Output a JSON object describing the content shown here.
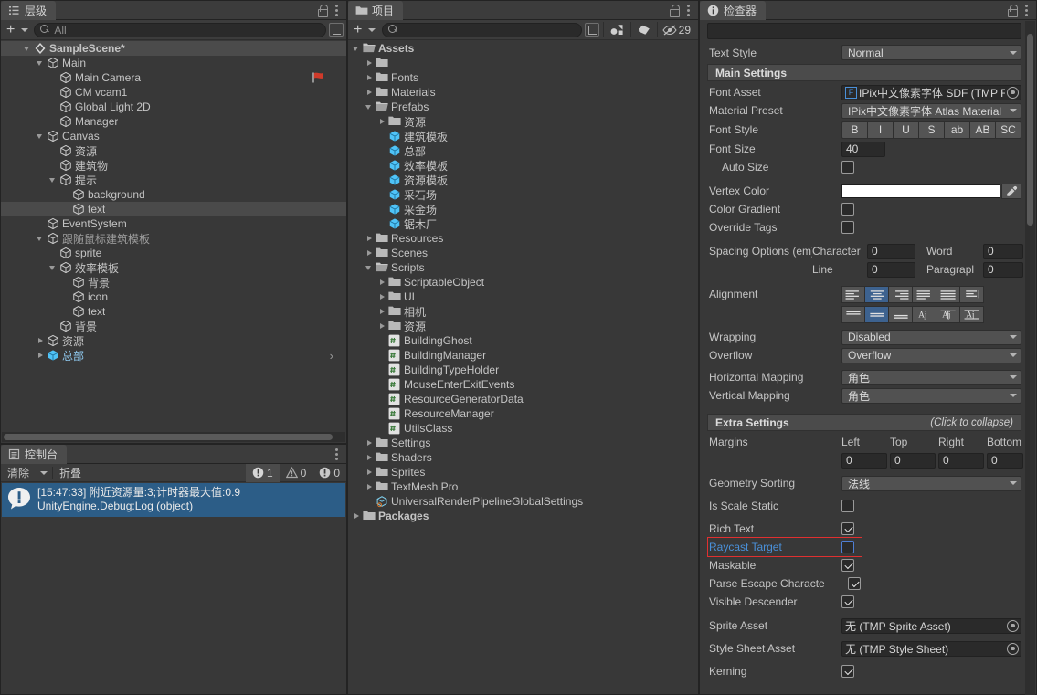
{
  "hierarchy": {
    "tab_label": "层级",
    "tab_icon": "hierarchy-icon",
    "search_placeholder": "All",
    "add_label": "+",
    "items": [
      {
        "label": "SampleScene*",
        "indent": 1,
        "arrow": "open",
        "icon": "unity-scene",
        "bold": true,
        "selected": false,
        "scene": true
      },
      {
        "label": "Main",
        "indent": 2,
        "arrow": "open",
        "icon": "gameobject",
        "bold": false,
        "selected": false
      },
      {
        "label": "Main Camera",
        "indent": 3,
        "arrow": "none",
        "icon": "gameobject",
        "bold": false,
        "selected": false,
        "tagicon": "camera-flag"
      },
      {
        "label": "CM vcam1",
        "indent": 3,
        "arrow": "none",
        "icon": "gameobject",
        "bold": false,
        "selected": false
      },
      {
        "label": "Global Light 2D",
        "indent": 3,
        "arrow": "none",
        "icon": "gameobject",
        "bold": false,
        "selected": false
      },
      {
        "label": "Manager",
        "indent": 3,
        "arrow": "none",
        "icon": "gameobject",
        "bold": false,
        "selected": false
      },
      {
        "label": "Canvas",
        "indent": 2,
        "arrow": "open",
        "icon": "gameobject",
        "bold": false,
        "selected": false
      },
      {
        "label": "资源",
        "indent": 3,
        "arrow": "none",
        "icon": "gameobject",
        "bold": false,
        "selected": false
      },
      {
        "label": "建筑物",
        "indent": 3,
        "arrow": "none",
        "icon": "gameobject",
        "bold": false,
        "selected": false
      },
      {
        "label": "提示",
        "indent": 3,
        "arrow": "open",
        "icon": "gameobject",
        "bold": false,
        "selected": false
      },
      {
        "label": "background",
        "indent": 4,
        "arrow": "none",
        "icon": "gameobject",
        "bold": false,
        "selected": false
      },
      {
        "label": "text",
        "indent": 4,
        "arrow": "none",
        "icon": "gameobject",
        "bold": false,
        "selected": true
      },
      {
        "label": "EventSystem",
        "indent": 2,
        "arrow": "none",
        "icon": "gameobject",
        "bold": false,
        "selected": false
      },
      {
        "label": "跟随鼠标建筑模板",
        "indent": 2,
        "arrow": "open",
        "icon": "gameobject",
        "bold": false,
        "selected": false,
        "dim": true
      },
      {
        "label": "sprite",
        "indent": 3,
        "arrow": "none",
        "icon": "gameobject",
        "bold": false,
        "selected": false
      },
      {
        "label": "效率模板",
        "indent": 3,
        "arrow": "open",
        "icon": "gameobject",
        "bold": false,
        "selected": false
      },
      {
        "label": "背景",
        "indent": 4,
        "arrow": "none",
        "icon": "gameobject",
        "bold": false,
        "selected": false
      },
      {
        "label": "icon",
        "indent": 4,
        "arrow": "none",
        "icon": "gameobject",
        "bold": false,
        "selected": false
      },
      {
        "label": "text",
        "indent": 4,
        "arrow": "none",
        "icon": "gameobject",
        "bold": false,
        "selected": false
      },
      {
        "label": "背景",
        "indent": 3,
        "arrow": "none",
        "icon": "gameobject",
        "bold": false,
        "selected": false
      },
      {
        "label": "资源",
        "indent": 2,
        "arrow": "closed",
        "icon": "gameobject",
        "bold": false,
        "selected": false
      },
      {
        "label": "总部",
        "indent": 2,
        "arrow": "closed",
        "icon": "prefab",
        "bold": false,
        "selected": false,
        "prefab": true
      }
    ]
  },
  "console": {
    "tab_label": "控制台",
    "tab_icon": "console-icon",
    "clear_label": "清除",
    "collapse_label": "折叠",
    "counts": {
      "info": "1",
      "warning": "0",
      "error": "0"
    },
    "entries": [
      {
        "icon": "info-icon",
        "line1": "[15:47:33] 附近资源量:3;计时器最大值:0.9",
        "line2": "UnityEngine.Debug:Log (object)",
        "selected": true
      }
    ]
  },
  "project": {
    "tab_label": "项目",
    "tab_icon": "folder-icon",
    "search_placeholder": "",
    "hidden_count": "29",
    "items": [
      {
        "label": "Assets",
        "indent": 0,
        "arrow": "open",
        "icon": "folder-open",
        "bold": true
      },
      {
        "label": "",
        "indent": 1,
        "arrow": "closed",
        "icon": "folder",
        "bold": false
      },
      {
        "label": "Fonts",
        "indent": 1,
        "arrow": "closed",
        "icon": "folder",
        "bold": false
      },
      {
        "label": "Materials",
        "indent": 1,
        "arrow": "closed",
        "icon": "folder",
        "bold": false
      },
      {
        "label": "Prefabs",
        "indent": 1,
        "arrow": "open",
        "icon": "folder-open",
        "bold": false
      },
      {
        "label": "资源",
        "indent": 2,
        "arrow": "closed",
        "icon": "folder",
        "bold": false
      },
      {
        "label": "建筑模板",
        "indent": 2,
        "arrow": "none",
        "icon": "prefab",
        "bold": false
      },
      {
        "label": "总部",
        "indent": 2,
        "arrow": "none",
        "icon": "prefab",
        "bold": false
      },
      {
        "label": "效率模板",
        "indent": 2,
        "arrow": "none",
        "icon": "prefab",
        "bold": false
      },
      {
        "label": "资源模板",
        "indent": 2,
        "arrow": "none",
        "icon": "prefab",
        "bold": false
      },
      {
        "label": "采石场",
        "indent": 2,
        "arrow": "none",
        "icon": "prefab",
        "bold": false
      },
      {
        "label": "采金场",
        "indent": 2,
        "arrow": "none",
        "icon": "prefab",
        "bold": false
      },
      {
        "label": "锯木厂",
        "indent": 2,
        "arrow": "none",
        "icon": "prefab",
        "bold": false
      },
      {
        "label": "Resources",
        "indent": 1,
        "arrow": "closed",
        "icon": "folder",
        "bold": false
      },
      {
        "label": "Scenes",
        "indent": 1,
        "arrow": "closed",
        "icon": "folder",
        "bold": false
      },
      {
        "label": "Scripts",
        "indent": 1,
        "arrow": "open",
        "icon": "folder-open",
        "bold": false
      },
      {
        "label": "ScriptableObject",
        "indent": 2,
        "arrow": "closed",
        "icon": "folder",
        "bold": false
      },
      {
        "label": "UI",
        "indent": 2,
        "arrow": "closed",
        "icon": "folder",
        "bold": false
      },
      {
        "label": "相机",
        "indent": 2,
        "arrow": "closed",
        "icon": "folder",
        "bold": false
      },
      {
        "label": "资源",
        "indent": 2,
        "arrow": "closed",
        "icon": "folder",
        "bold": false
      },
      {
        "label": "BuildingGhost",
        "indent": 2,
        "arrow": "none",
        "icon": "csharp",
        "bold": false
      },
      {
        "label": "BuildingManager",
        "indent": 2,
        "arrow": "none",
        "icon": "csharp",
        "bold": false
      },
      {
        "label": "BuildingTypeHolder",
        "indent": 2,
        "arrow": "none",
        "icon": "csharp",
        "bold": false
      },
      {
        "label": "MouseEnterExitEvents",
        "indent": 2,
        "arrow": "none",
        "icon": "csharp",
        "bold": false
      },
      {
        "label": "ResourceGeneratorData",
        "indent": 2,
        "arrow": "none",
        "icon": "csharp",
        "bold": false
      },
      {
        "label": "ResourceManager",
        "indent": 2,
        "arrow": "none",
        "icon": "csharp",
        "bold": false
      },
      {
        "label": "UtilsClass",
        "indent": 2,
        "arrow": "none",
        "icon": "csharp",
        "bold": false
      },
      {
        "label": "Settings",
        "indent": 1,
        "arrow": "closed",
        "icon": "folder",
        "bold": false
      },
      {
        "label": "Shaders",
        "indent": 1,
        "arrow": "closed",
        "icon": "folder",
        "bold": false
      },
      {
        "label": "Sprites",
        "indent": 1,
        "arrow": "closed",
        "icon": "folder",
        "bold": false
      },
      {
        "label": "TextMesh Pro",
        "indent": 1,
        "arrow": "closed",
        "icon": "folder",
        "bold": false
      },
      {
        "label": "UniversalRenderPipelineGlobalSettings",
        "indent": 1,
        "arrow": "none",
        "icon": "asset",
        "bold": false
      },
      {
        "label": "Packages",
        "indent": 0,
        "arrow": "closed",
        "icon": "folder",
        "bold": true
      }
    ]
  },
  "inspector": {
    "tab_label": "检查器",
    "tab_icon": "info-icon",
    "text_style": {
      "label": "Text Style",
      "value": "Normal"
    },
    "main_settings": {
      "header": "Main Settings"
    },
    "font_asset": {
      "label": "Font Asset",
      "value": "IPix中文像素字体 SDF (TMP For",
      "badge": "F"
    },
    "material_preset": {
      "label": "Material Preset",
      "value": "IPix中文像素字体 Atlas Material"
    },
    "font_style": {
      "label": "Font Style",
      "buttons": [
        "B",
        "I",
        "U",
        "S",
        "ab",
        "AB",
        "SC"
      ]
    },
    "font_size": {
      "label": "Font Size",
      "value": "40"
    },
    "auto_size": {
      "label": "Auto Size",
      "checked": false
    },
    "vertex_color": {
      "label": "Vertex Color",
      "color": "#ffffff"
    },
    "color_gradient": {
      "label": "Color Gradient",
      "checked": false
    },
    "override_tags": {
      "label": "Override Tags",
      "checked": false
    },
    "spacing": {
      "label": "Spacing Options (em)",
      "character_label": "Character",
      "character": "0",
      "word_label": "Word",
      "word": "0",
      "line_label": "Line",
      "line": "0",
      "paragraph_label": "Paragrapl",
      "paragraph": "0"
    },
    "alignment": {
      "label": "Alignment",
      "h_active": 1,
      "v_active": 1
    },
    "wrapping": {
      "label": "Wrapping",
      "value": "Disabled"
    },
    "overflow": {
      "label": "Overflow",
      "value": "Overflow"
    },
    "horizontal_mapping": {
      "label": "Horizontal Mapping",
      "value": "角色"
    },
    "vertical_mapping": {
      "label": "Vertical Mapping",
      "value": "角色"
    },
    "extra_settings": {
      "header": "Extra Settings",
      "hint": "(Click to collapse)"
    },
    "margins": {
      "label": "Margins",
      "left_label": "Left",
      "left": "0",
      "top_label": "Top",
      "top": "0",
      "right_label": "Right",
      "right": "0",
      "bottom_label": "Bottom",
      "bottom": "0"
    },
    "geometry_sorting": {
      "label": "Geometry Sorting",
      "value": "法线"
    },
    "is_scale_static": {
      "label": "Is Scale Static",
      "checked": false
    },
    "rich_text": {
      "label": "Rich Text",
      "checked": true
    },
    "raycast_target": {
      "label": "Raycast Target",
      "checked": false,
      "highlighted": true,
      "highlight_color": "#e03030",
      "label_color": "#4a90d9"
    },
    "maskable": {
      "label": "Maskable",
      "checked": true
    },
    "parse_escape": {
      "label": "Parse Escape Characte",
      "checked": true
    },
    "visible_descender": {
      "label": "Visible Descender",
      "checked": true
    },
    "sprite_asset": {
      "label": "Sprite Asset",
      "value": "无 (TMP Sprite Asset)"
    },
    "style_sheet_asset": {
      "label": "Style Sheet Asset",
      "value": "无 (TMP Style Sheet)"
    },
    "kerning": {
      "label": "Kerning",
      "checked": true
    }
  }
}
